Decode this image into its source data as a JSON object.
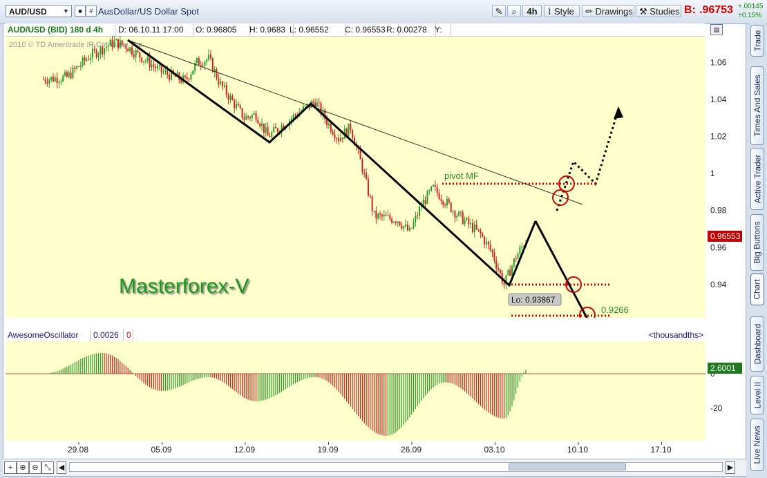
{
  "toolbar": {
    "symbol": "AUD/USD",
    "description": "AusDollar/US Dollar Spot",
    "timeframe": "4h",
    "style_label": "Style",
    "drawings_label": "Drawings",
    "studies_label": "Studies",
    "bid_label": "B:",
    "bid_value": ".96753",
    "change_abs": "+.00145",
    "change_pct": "+0.15%"
  },
  "info_bar": {
    "title": "AUD/USD (BID) 180 d 4h",
    "date": "D: 06.10.11 17:00",
    "open": "O: 0.96805",
    "high": "H: 0.9683",
    "low": "L: 0.96552",
    "close": "C: 0.96553",
    "range": "R: 0.00278",
    "y": "Y:"
  },
  "copyright": "2010 © TD Ameritrade IP Company, Inc.",
  "watermark": "Masterforex-V",
  "annotations": {
    "pivot": "pivot MF",
    "low_label": "Lo: 0.93867",
    "target": "0.9266"
  },
  "oscillator": {
    "name": "AwesomeOscillator",
    "value": "0.0026",
    "value2": "0",
    "units": "<thousandths>",
    "current_label": "2.6001"
  },
  "side_tabs": [
    "Trade",
    "Times And Sales",
    "Active Trader",
    "Big Buttons",
    "Chart",
    "Dashboard",
    "Level II",
    "Live News"
  ],
  "colors": {
    "chart_bg": "#ffffcc",
    "up_candle": "#2a9a2a",
    "down_candle": "#cc2222",
    "annotation_red": "#cc0000",
    "annotation_green": "#2a8a2a"
  },
  "chart_data": [
    {
      "type": "candlestick",
      "title": "AUD/USD (BID) 180 d 4h",
      "x_tick_labels": [
        "29.08",
        "05.09",
        "12.09",
        "19.09",
        "26.09",
        "03.10",
        "10.10",
        "17.10"
      ],
      "y_tick_labels": [
        "1.06",
        "1.04",
        "1.02",
        "1",
        "0.98",
        "0.96",
        "0.94"
      ],
      "ylim": [
        0.922,
        1.074
      ],
      "last_price_label": "0.96553",
      "approx_close_path": [
        {
          "x": "26.08",
          "y": 1.051
        },
        {
          "x": "28.08",
          "y": 1.052
        },
        {
          "x": "30.08",
          "y": 1.064
        },
        {
          "x": "01.09",
          "y": 1.071
        },
        {
          "x": "02.09",
          "y": 1.069
        },
        {
          "x": "05.09",
          "y": 1.055
        },
        {
          "x": "07.09",
          "y": 1.05
        },
        {
          "x": "08.09",
          "y": 1.06
        },
        {
          "x": "09.09",
          "y": 1.062
        },
        {
          "x": "10.09",
          "y": 1.048
        },
        {
          "x": "12.09",
          "y": 1.03
        },
        {
          "x": "13.09",
          "y": 1.032
        },
        {
          "x": "14.09",
          "y": 1.02
        },
        {
          "x": "16.09",
          "y": 1.03
        },
        {
          "x": "18.09",
          "y": 1.039
        },
        {
          "x": "19.09",
          "y": 1.028
        },
        {
          "x": "20.09",
          "y": 1.019
        },
        {
          "x": "21.09",
          "y": 1.025
        },
        {
          "x": "22.09",
          "y": 1.003
        },
        {
          "x": "23.09",
          "y": 0.977
        },
        {
          "x": "25.09",
          "y": 0.975
        },
        {
          "x": "26.09",
          "y": 0.968
        },
        {
          "x": "27.09",
          "y": 0.983
        },
        {
          "x": "28.09",
          "y": 0.992
        },
        {
          "x": "29.09",
          "y": 0.985
        },
        {
          "x": "30.09",
          "y": 0.978
        },
        {
          "x": "02.10",
          "y": 0.967
        },
        {
          "x": "03.10",
          "y": 0.957
        },
        {
          "x": "04.10",
          "y": 0.94
        },
        {
          "x": "05.10",
          "y": 0.955
        },
        {
          "x": "06.10",
          "y": 0.9655
        }
      ]
    },
    {
      "type": "bar",
      "title": "AwesomeOscillator",
      "y_tick_labels": [
        "0",
        "-20"
      ],
      "current_value": 2.6001,
      "approx_profile": [
        {
          "x": "26.08",
          "y": 0
        },
        {
          "x": "31.08",
          "y": 12
        },
        {
          "x": "05.09",
          "y": -10
        },
        {
          "x": "09.09",
          "y": -2
        },
        {
          "x": "13.09",
          "y": -16
        },
        {
          "x": "18.09",
          "y": -2
        },
        {
          "x": "24.09",
          "y": -36
        },
        {
          "x": "29.09",
          "y": -5
        },
        {
          "x": "04.10",
          "y": -26
        },
        {
          "x": "06.10",
          "y": 2.6
        }
      ]
    }
  ]
}
